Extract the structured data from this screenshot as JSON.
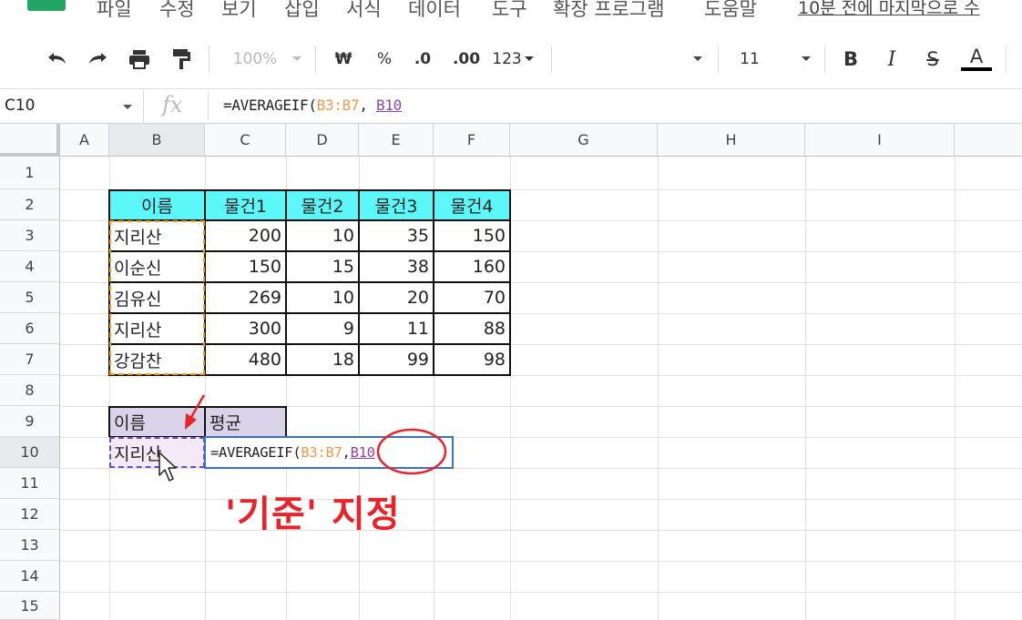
{
  "menu": {
    "items": [
      "파일",
      "수정",
      "보기",
      "삽입",
      "서식",
      "데이터",
      "도구",
      "확장 프로그램",
      "도움말"
    ],
    "last_edit": "10분 전에 마지막으로 수"
  },
  "toolbar": {
    "undo_icon": "undo-icon",
    "redo_icon": "redo-icon",
    "print_icon": "print-icon",
    "paint_format_icon": "paint-format-icon",
    "zoom": "100%",
    "currency": "₩",
    "percent": "%",
    "decrease_decimal": ".0",
    "increase_decimal": ".00",
    "number_format": "123",
    "font_size": "11",
    "bold": "B",
    "italic": "I",
    "strikethrough": "S",
    "text_color": "A"
  },
  "formula_bar": {
    "cell_ref": "C10",
    "fx": "fx",
    "formula_prefix": "=AVERAGEIF(",
    "formula_range": "B3:B7",
    "formula_sep": ", ",
    "formula_criteria": "B10"
  },
  "columns": [
    "A",
    "B",
    "C",
    "D",
    "E",
    "F",
    "G",
    "H",
    "I"
  ],
  "rows": [
    "1",
    "2",
    "3",
    "4",
    "5",
    "6",
    "7",
    "8",
    "9",
    "10",
    "11",
    "12",
    "13",
    "14",
    "15"
  ],
  "table": {
    "headers": [
      "이름",
      "물건1",
      "물건2",
      "물건3",
      "물건4"
    ],
    "rows": [
      {
        "name": "지리산",
        "v1": "200",
        "v2": "10",
        "v3": "35",
        "v4": "150"
      },
      {
        "name": "이순신",
        "v1": "150",
        "v2": "15",
        "v3": "38",
        "v4": "160"
      },
      {
        "name": "김유신",
        "v1": "269",
        "v2": "10",
        "v3": "20",
        "v4": "70"
      },
      {
        "name": "지리산",
        "v1": "300",
        "v2": "9",
        "v3": "11",
        "v4": "88"
      },
      {
        "name": "강감찬",
        "v1": "480",
        "v2": "18",
        "v3": "99",
        "v4": "98"
      }
    ]
  },
  "summary": {
    "header_name": "이름",
    "header_avg": "평균",
    "criteria_value": "지리산",
    "formula_prefix": "=AVERAGEIF(",
    "formula_range": "B3:B7",
    "formula_sep": ", ",
    "formula_criteria": "B10"
  },
  "annotation": {
    "text": "'기준' 지정",
    "color": "#e8242a"
  },
  "colors": {
    "header_cyan": "#5cf7f8",
    "header_lavender": "#d9d2e9",
    "range_orange": "#f39c12",
    "criteria_purple": "#8e44ad",
    "active_border": "#3b6fd8"
  }
}
